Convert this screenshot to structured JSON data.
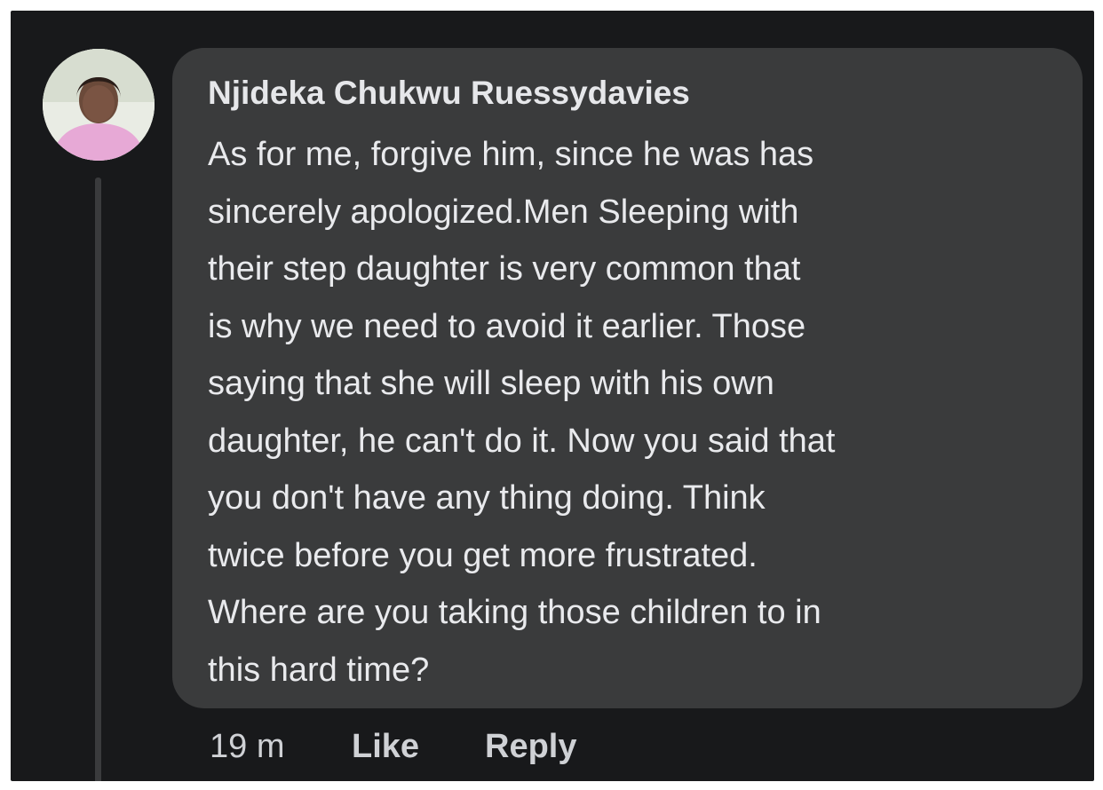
{
  "comment": {
    "author_name": "Njideka Chukwu Ruessydavies",
    "text": "As for me, forgive him, since he was has\nsincerely apologized.Men Sleeping with\ntheir step daughter is very common that\nis why we need to avoid it earlier. Those\nsaying that she will sleep with his own\ndaughter, he can't do it. Now you said that\nyou don't have any thing doing. Think\ntwice before you get more frustrated.\nWhere are you taking those children to in\nthis hard time?",
    "avatar_icon": "profile-photo",
    "timestamp": "19 m",
    "like_label": "Like",
    "reply_label": "Reply"
  },
  "colors": {
    "background": "#18191b",
    "bubble": "#3a3b3c",
    "text": "#e9eaed",
    "meta_text": "#cfd1d5"
  }
}
